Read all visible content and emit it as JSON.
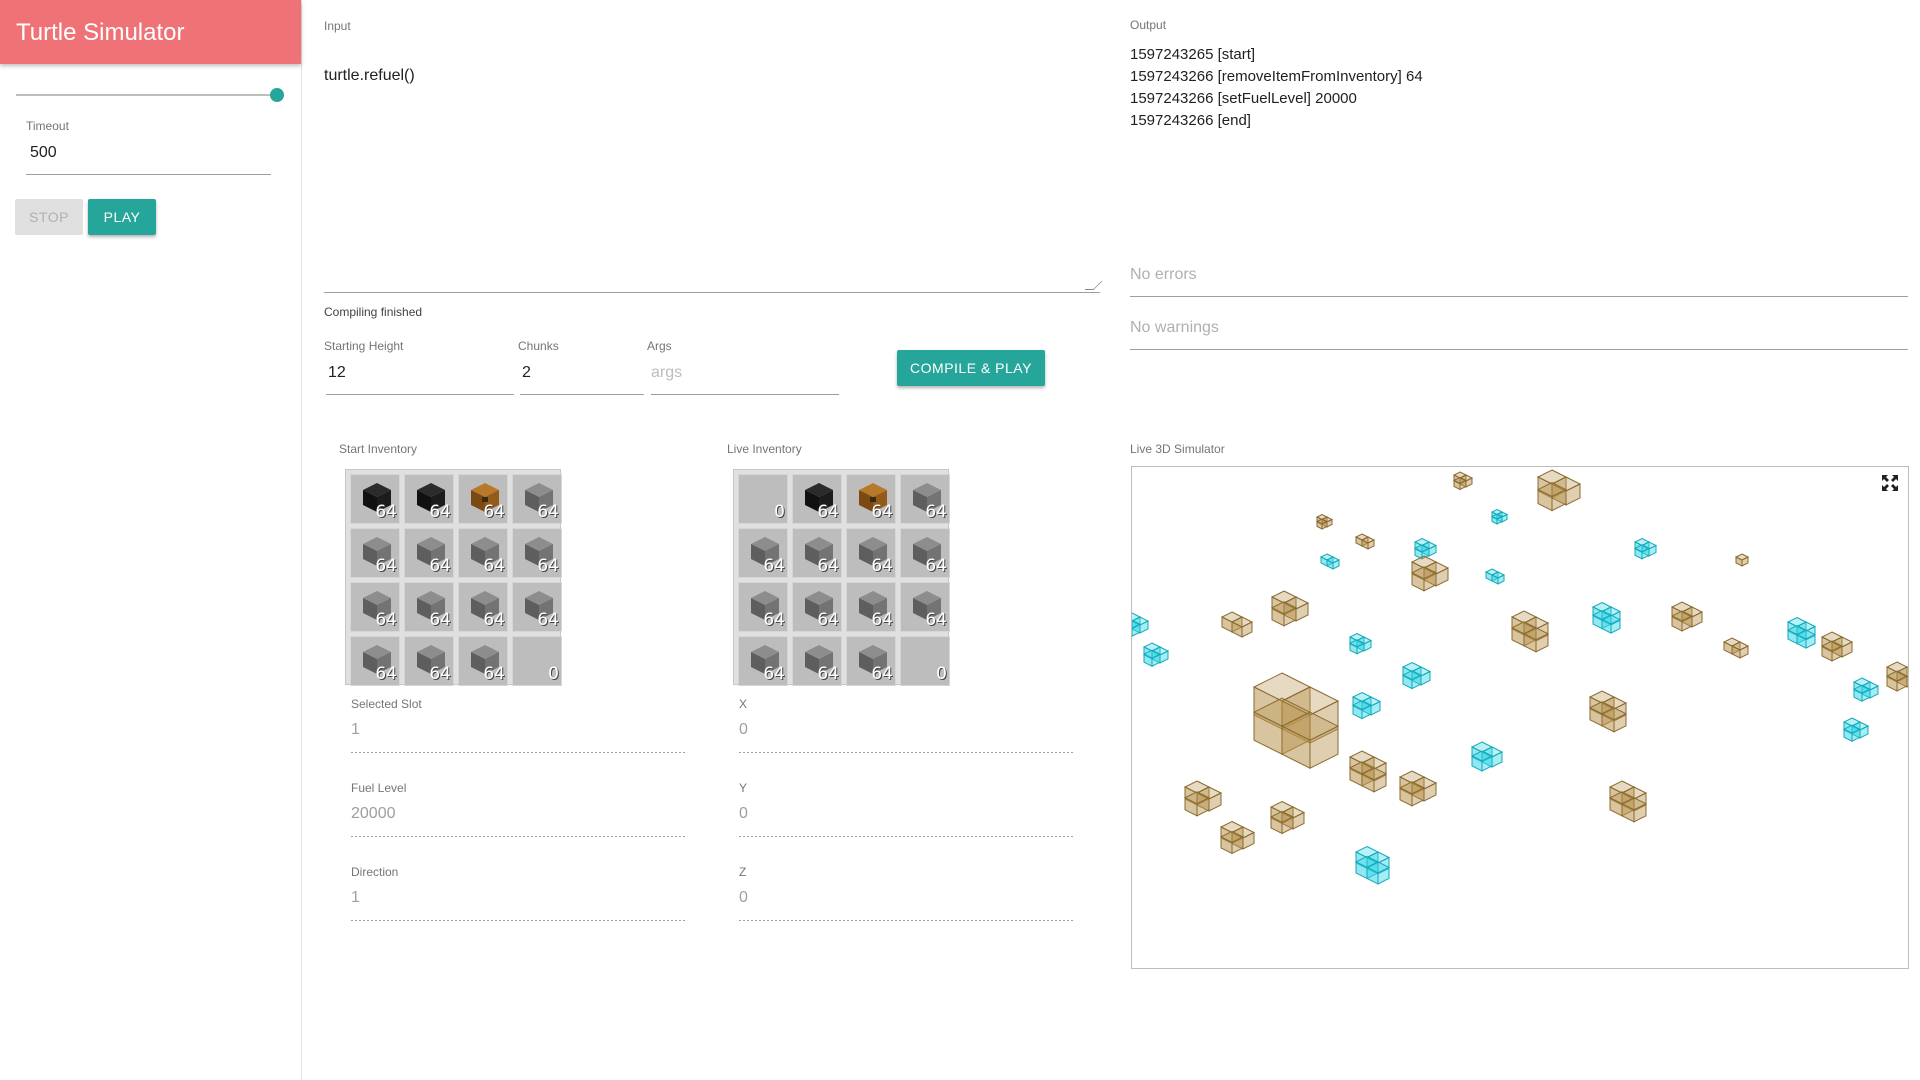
{
  "app": {
    "title": "Turtle Simulator"
  },
  "sidebar": {
    "speed_slider_value": 1.0,
    "timeout_label": "Timeout",
    "timeout_value": "500",
    "stop_label": "STOP",
    "play_label": "PLAY"
  },
  "input": {
    "label": "Input",
    "code": "turtle.refuel()",
    "status": "Compiling finished"
  },
  "params": {
    "starting_height_label": "Starting Height",
    "starting_height_value": "12",
    "chunks_label": "Chunks",
    "chunks_value": "2",
    "args_label": "Args",
    "args_placeholder": "args",
    "compile_button": "COMPILE & PLAY"
  },
  "output": {
    "label": "Output",
    "lines": [
      "1597243265 [start]",
      "1597243266 [removeItemFromInventory] 64",
      "1597243266 [setFuelLevel] 20000",
      "1597243266 [end]"
    ],
    "errors_placeholder": "No errors",
    "warnings_placeholder": "No warnings"
  },
  "start_inventory": {
    "label": "Start Inventory",
    "slots": [
      {
        "item": "coal",
        "count": "64"
      },
      {
        "item": "coal",
        "count": "64"
      },
      {
        "item": "chest",
        "count": "64"
      },
      {
        "item": "stone",
        "count": "64"
      },
      {
        "item": "stone",
        "count": "64"
      },
      {
        "item": "stone",
        "count": "64"
      },
      {
        "item": "stone",
        "count": "64"
      },
      {
        "item": "stone",
        "count": "64"
      },
      {
        "item": "stone",
        "count": "64"
      },
      {
        "item": "stone",
        "count": "64"
      },
      {
        "item": "stone",
        "count": "64"
      },
      {
        "item": "stone",
        "count": "64"
      },
      {
        "item": "stone",
        "count": "64"
      },
      {
        "item": "stone",
        "count": "64"
      },
      {
        "item": "stone",
        "count": "64"
      },
      {
        "item": "empty",
        "count": "0"
      }
    ]
  },
  "live_inventory": {
    "label": "Live Inventory",
    "slots": [
      {
        "item": "empty",
        "count": "0"
      },
      {
        "item": "coal",
        "count": "64"
      },
      {
        "item": "chest",
        "count": "64"
      },
      {
        "item": "stone",
        "count": "64"
      },
      {
        "item": "stone",
        "count": "64"
      },
      {
        "item": "stone",
        "count": "64"
      },
      {
        "item": "stone",
        "count": "64"
      },
      {
        "item": "stone",
        "count": "64"
      },
      {
        "item": "stone",
        "count": "64"
      },
      {
        "item": "stone",
        "count": "64"
      },
      {
        "item": "stone",
        "count": "64"
      },
      {
        "item": "stone",
        "count": "64"
      },
      {
        "item": "stone",
        "count": "64"
      },
      {
        "item": "stone",
        "count": "64"
      },
      {
        "item": "stone",
        "count": "64"
      },
      {
        "item": "empty",
        "count": "0"
      }
    ]
  },
  "turtle_state": {
    "selected_slot_label": "Selected Slot",
    "selected_slot": "1",
    "fuel_level_label": "Fuel Level",
    "fuel_level": "20000",
    "direction_label": "Direction",
    "direction": "1",
    "x_label": "X",
    "x": "0",
    "y_label": "Y",
    "y": "0",
    "z_label": "Z",
    "z": "0"
  },
  "simulator": {
    "label": "Live 3D Simulator",
    "fullscreen_icon": "fullscreen-icon",
    "colors": {
      "dirt": "#b8944f",
      "diamond": "#37d6e6"
    }
  },
  "colors": {
    "app_bar": "#ef7376",
    "accent": "#26a69a"
  }
}
